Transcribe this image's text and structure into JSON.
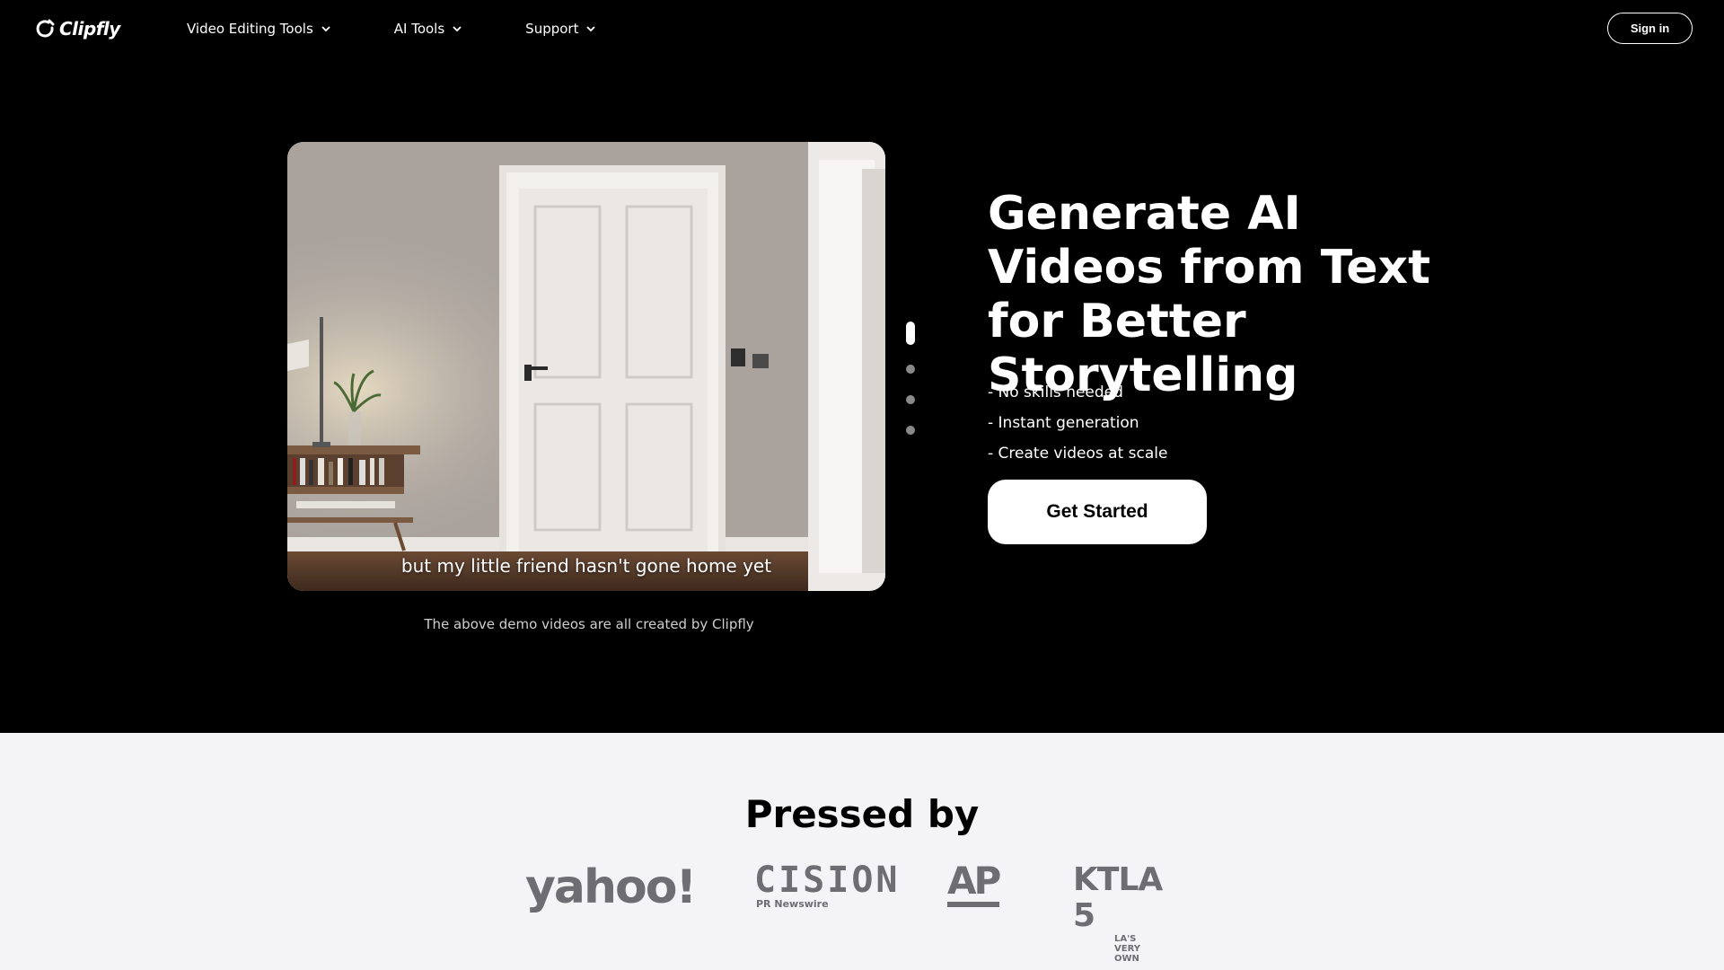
{
  "header": {
    "logo_text": "Clipfly",
    "nav": [
      {
        "label": "Video Editing Tools"
      },
      {
        "label": "AI Tools"
      },
      {
        "label": "Support"
      }
    ],
    "signin_label": "Sign in"
  },
  "hero": {
    "video_subtitle": "but my little friend hasn't gone home yet",
    "caption": "The above demo videos are all created by Clipfly",
    "headline": "Generate AI Videos from Text for Better Storytelling",
    "features": [
      "- No skills needed",
      "- Instant generation",
      "- Create videos at scale"
    ],
    "cta_label": "Get Started",
    "carousel": {
      "count": 4,
      "active_index": 0
    }
  },
  "press": {
    "title": "Pressed by",
    "logos": {
      "yahoo": "yahoo!",
      "cision": "CISION",
      "cision_sub": "PR Newswire",
      "ap": "AP",
      "ktla": "KTLA 5",
      "ktla_sub": "LA'S VERY OWN"
    }
  },
  "colors": {
    "hero_bg": "#000000",
    "press_bg": "#f4f4f6",
    "logo_gray": "#6e6e72"
  }
}
